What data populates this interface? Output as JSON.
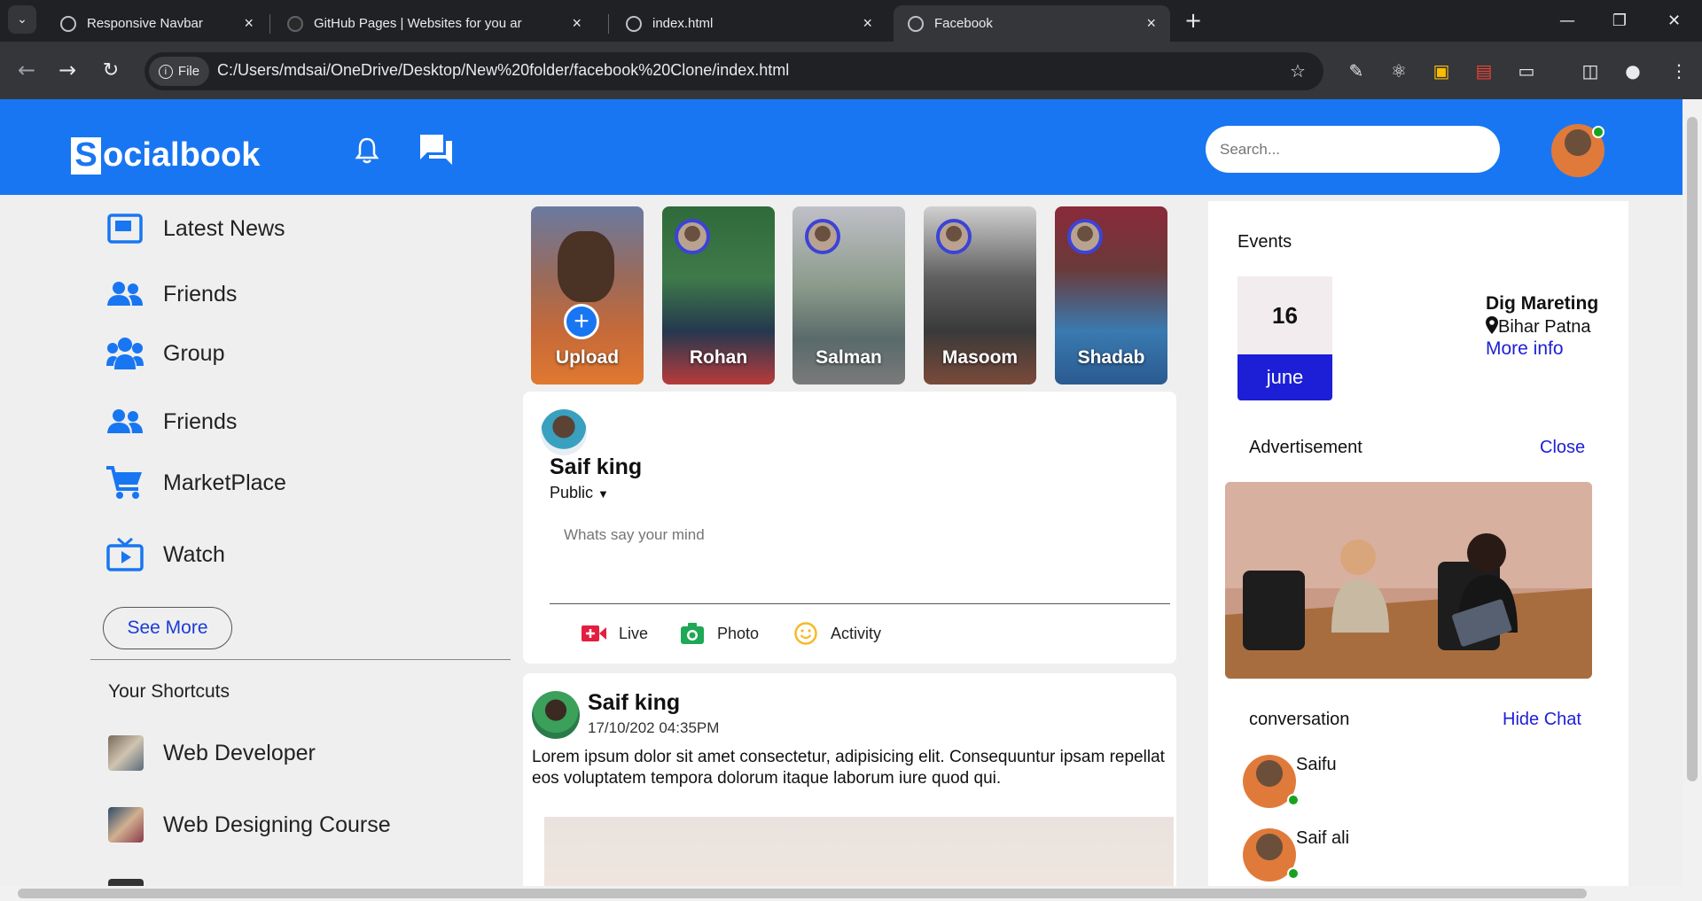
{
  "browser": {
    "tabs": [
      {
        "title": "Responsive Navbar"
      },
      {
        "title": "GitHub Pages | Websites for you ar"
      },
      {
        "title": "index.html"
      },
      {
        "title": "Facebook"
      }
    ],
    "file_chip": "File",
    "url": "C:/Users/mdsai/OneDrive/Desktop/New%20folder/facebook%20Clone/index.html"
  },
  "navbar": {
    "logo_letter": "S",
    "logo_rest": "ocialbook",
    "search_placeholder": "Search..."
  },
  "sidebar": {
    "items": [
      {
        "label": "Latest News",
        "icon": "news-icon"
      },
      {
        "label": "Friends",
        "icon": "friends-icon"
      },
      {
        "label": "Group",
        "icon": "group-icon"
      },
      {
        "label": "Friends",
        "icon": "friends-icon"
      },
      {
        "label": "MarketPlace",
        "icon": "cart-icon"
      },
      {
        "label": "Watch",
        "icon": "tv-icon"
      }
    ],
    "see_more": "See More",
    "shortcuts_title": "Your Shortcuts",
    "shortcuts": [
      {
        "label": "Web Developer"
      },
      {
        "label": "Web Designing Course"
      }
    ]
  },
  "stories": [
    {
      "name": "Upload"
    },
    {
      "name": "Rohan"
    },
    {
      "name": "Salman"
    },
    {
      "name": "Masoom"
    },
    {
      "name": "Shadab"
    }
  ],
  "create_post": {
    "user": "Saif king",
    "visibility": "Public",
    "placeholder": "Whats say your mind",
    "actions": [
      {
        "label": "Live",
        "icon": "live-video-icon",
        "color": "#e41e3f"
      },
      {
        "label": "Photo",
        "icon": "camera-icon",
        "color": "#1fa855"
      },
      {
        "label": "Activity",
        "icon": "smile-icon",
        "color": "#f7b928"
      }
    ]
  },
  "post": {
    "user": "Saif king",
    "time": "17/10/202 04:35PM",
    "text": "Lorem ipsum dolor sit amet consectetur, adipisicing elit. Consequuntur ipsam repellat eos voluptatem tempora dolorum itaque laborum iure quod qui."
  },
  "events": {
    "title": "Events",
    "day": "16",
    "month": "june",
    "name": "Dig Mareting",
    "location": "Bihar Patna",
    "more": "More info"
  },
  "advertisement": {
    "title": "Advertisement",
    "close": "Close"
  },
  "conversation": {
    "title": "conversation",
    "hide": "Hide Chat",
    "contacts": [
      {
        "name": "Saifu",
        "online": true
      },
      {
        "name": "Saif ali",
        "online": true
      }
    ]
  },
  "colors": {
    "brand": "#1876f2",
    "link": "#1d1fd6",
    "online": "#18a21f"
  }
}
